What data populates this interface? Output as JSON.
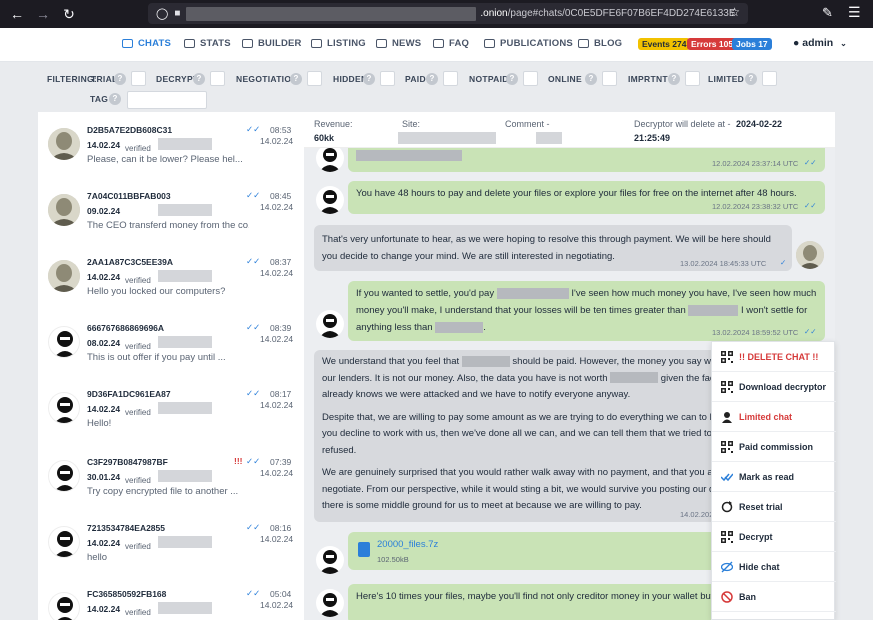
{
  "browser": {
    "url_host": ".onion",
    "url_path": "/page#chats/0C0E5DFE6F07B6EF4DD274E6133E"
  },
  "nav": {
    "items": [
      {
        "label": "CHATS",
        "icon": "chat-icon",
        "active": true
      },
      {
        "label": "STATS",
        "icon": "chart-icon"
      },
      {
        "label": "BUILDER",
        "icon": "builder-icon"
      },
      {
        "label": "LISTING",
        "icon": "listing-icon"
      },
      {
        "label": "NEWS",
        "icon": "news-icon"
      },
      {
        "label": "FAQ",
        "icon": "faq-icon"
      },
      {
        "label": "PUBLICATIONS",
        "icon": "publications-icon"
      },
      {
        "label": "BLOG",
        "icon": "blog-icon"
      }
    ],
    "badges": [
      {
        "label": "Events 274",
        "color": "#f2c200",
        "text": "#1e2a3a"
      },
      {
        "label": "Errors 105",
        "color": "#d63a3a",
        "text": "#ffffff"
      },
      {
        "label": "Jobs 17",
        "color": "#2b7fd9",
        "text": "#ffffff"
      }
    ],
    "user": "admin"
  },
  "filters": {
    "title": "FILTERING:",
    "items": [
      "TRIAL",
      "DECRYPT",
      "NEGOTIATION",
      "HIDDEN",
      "PAID",
      "NOTPAID",
      "ONLINE",
      "IMPRTNT",
      "LIMITED"
    ],
    "tag": "TAG"
  },
  "chats": [
    {
      "id": "D2B5A7E2DB608C31",
      "date": "14.02.24",
      "verified": "verified",
      "preview": "Please, can it be lower? Please hel...",
      "time": "08:53",
      "day": "14.02.24",
      "avatar": "franklin",
      "important": false
    },
    {
      "id": "7A04C011BBFAB003",
      "date": "09.02.24",
      "verified": "",
      "preview": "The CEO transferd money from the co...",
      "time": "08:45",
      "day": "14.02.24",
      "avatar": "franklin",
      "important": false
    },
    {
      "id": "2AA1A87C3C5EE39A",
      "date": "14.02.24",
      "verified": "verified",
      "preview": "Hello you locked our computers?",
      "time": "08:37",
      "day": "14.02.24",
      "avatar": "franklin",
      "important": false
    },
    {
      "id": "666767686869696A",
      "date": "08.02.24",
      "verified": "verified",
      "preview": "This is out offer if you pay until ...",
      "time": "08:39",
      "day": "14.02.24",
      "avatar": "hacker",
      "important": false
    },
    {
      "id": "9D36FA1DC961EA87",
      "date": "14.02.24",
      "verified": "verified",
      "preview": "Hello!",
      "time": "08:17",
      "day": "14.02.24",
      "avatar": "hacker",
      "important": false
    },
    {
      "id": "C3F297B0847987BF",
      "date": "30.01.24",
      "verified": "verified",
      "preview": "Try copy encrypted file to another ...",
      "time": "07:39",
      "day": "14.02.24",
      "avatar": "hacker",
      "important": true
    },
    {
      "id": "7213534784EA2855",
      "date": "14.02.24",
      "verified": "verified",
      "preview": "hello",
      "time": "08:16",
      "day": "14.02.24",
      "avatar": "hacker",
      "important": false
    },
    {
      "id": "FC365850592FB168",
      "date": "14.02.24",
      "verified": "verified",
      "preview": "",
      "time": "05:04",
      "day": "14.02.24",
      "avatar": "hacker",
      "important": false
    }
  ],
  "header": {
    "revenue_label": "Revenue:",
    "revenue_value": "60kk",
    "site_label": "Site:",
    "comment_label": "Comment -",
    "decryptor_label": "Decryptor will delete at -",
    "decryptor_date": "2024-02-22",
    "decryptor_time": "21:25:49"
  },
  "messages": [
    {
      "side": "out",
      "meta": "12.02.2024  23:37:14  UTC"
    },
    {
      "side": "out",
      "text": "You have 48 hours to pay and delete your files or explore your files for free on the internet after 48 hours.",
      "meta": "12.02.2024  23:38:32  UTC"
    },
    {
      "side": "in",
      "text": "That's very unfortunate to hear, as we were hoping to resolve this through payment. We will be here should you decide to change your mind. We are still interested in negotiating.",
      "meta": "13.02.2024   18:45:33   UTC"
    },
    {
      "side": "out",
      "p1": "If you wanted to settle, you'd pay",
      "p2": "I've seen how much money you have, I've seen how much money you'll make, I understand that your losses will be ten times greater than",
      "p3": "I won't settle for anything less than",
      "p4": ".",
      "meta": "13.02.2024  18:59:52  UTC"
    },
    {
      "side": "in",
      "p1": "We understand that you feel that",
      "p2": "should be paid. However, the money you say we h",
      "p3": "our lenders. It is not our money. Also, the data you have is not worth",
      "p4": "given the fact t",
      "p5": "already knows we were attacked and we have to notify everyone anyway.",
      "p6": "Despite that, we are willing to pay some amount as we are trying to do everything we can to hel",
      "p7": "you decline to work with us, then we've done all we can, and we can tell them that we tried to n",
      "p8": "refused.",
      "p9": "We are genuinely surprised that you would rather walk away with no payment, and that you are",
      "p10": "negotiate. From our perspective, while it would sting a bit, we would survive you posting our dat",
      "p11": "there is some middle ground for us to meet at because we are willing to pay.",
      "meta": "14.02.202"
    },
    {
      "side": "out",
      "file": "20000_files.7z",
      "size": "102.50kB"
    },
    {
      "side": "out",
      "text": "Here's 10 times your files, maybe you'll find not only creditor money in your wallet but al"
    }
  ],
  "context_menu": [
    {
      "label": "!! DELETE CHAT !!",
      "icon": "qr-icon",
      "color": "#d63a3a"
    },
    {
      "label": "Download decryptor",
      "icon": "qr-icon"
    },
    {
      "label": "Limited chat",
      "icon": "user-icon",
      "color": "#d63a3a"
    },
    {
      "label": "Paid commission",
      "icon": "qr-icon"
    },
    {
      "label": "Mark as read",
      "icon": "double-check-icon"
    },
    {
      "label": "Reset trial",
      "icon": "reset-icon"
    },
    {
      "label": "Decrypt",
      "icon": "qr-icon"
    },
    {
      "label": "Hide chat",
      "icon": "eye-slash-icon"
    },
    {
      "label": "Ban",
      "icon": "ban-icon"
    }
  ]
}
